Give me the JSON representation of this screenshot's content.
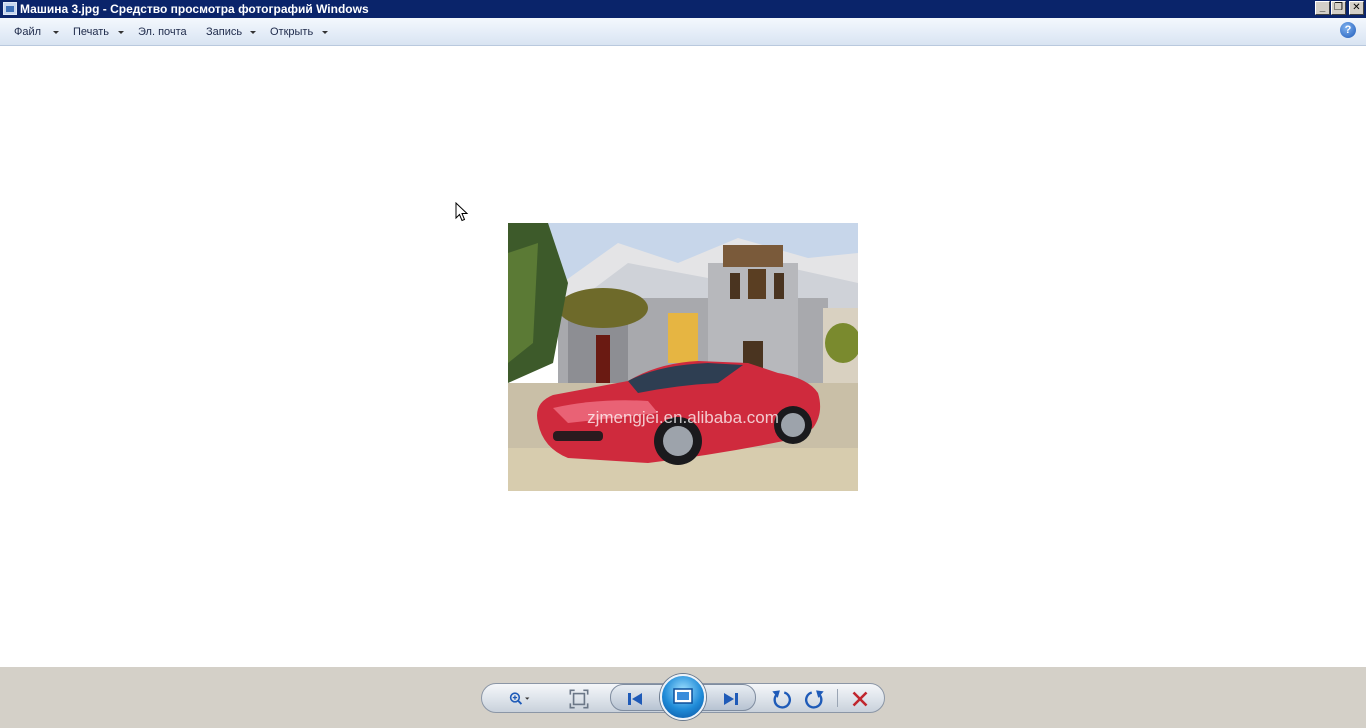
{
  "window": {
    "title": "Машина 3.jpg - Средство просмотра фотографий Windows",
    "controls": {
      "minimize": "_",
      "restore": "❐",
      "close": "✕"
    }
  },
  "menu": {
    "items": [
      {
        "label": "Файл",
        "has_dropdown": true
      },
      {
        "label": "Печать",
        "has_dropdown": true
      },
      {
        "label": "Эл. почта",
        "has_dropdown": false
      },
      {
        "label": "Запись",
        "has_dropdown": true
      },
      {
        "label": "Открыть",
        "has_dropdown": true
      }
    ],
    "help": "?"
  },
  "photo": {
    "watermark": "zjmengjei.en.alibaba.com"
  },
  "controls": {
    "icons": [
      "zoom-icon",
      "actual-size-icon",
      "previous-icon",
      "slideshow-icon",
      "next-icon",
      "rotate-left-icon",
      "rotate-right-icon",
      "delete-icon"
    ],
    "colors": {
      "accent": "#1f5bb8",
      "delete": "#c0262d",
      "titlebar": "#0a246a",
      "bar": "#d4d0c8"
    }
  }
}
